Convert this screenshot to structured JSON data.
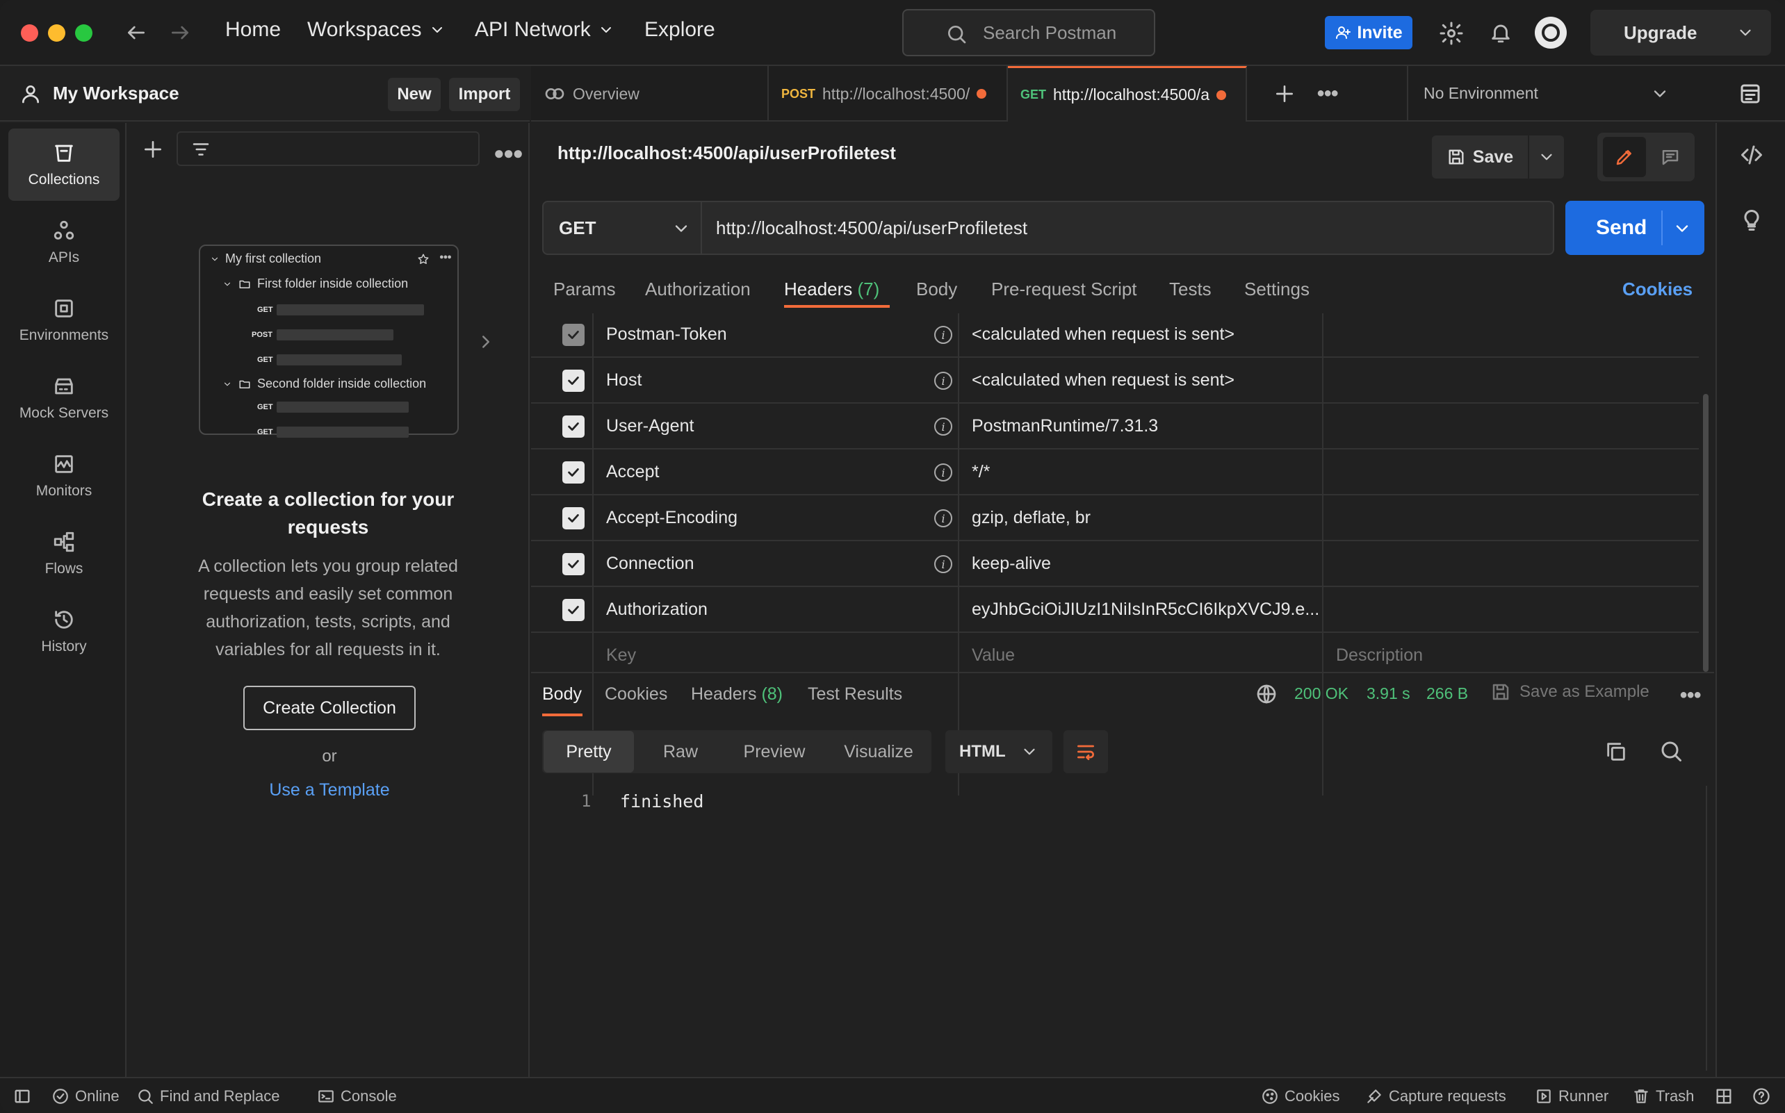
{
  "topbar": {
    "nav": {
      "home": "Home",
      "workspaces": "Workspaces",
      "api_network": "API Network",
      "explore": "Explore"
    },
    "search_placeholder": "Search Postman",
    "invite_label": "Invite",
    "upgrade_label": "Upgrade"
  },
  "workspace": {
    "title": "My Workspace",
    "new_label": "New",
    "import_label": "Import"
  },
  "leftnav": {
    "items": [
      {
        "label": "Collections",
        "icon": "collections-icon"
      },
      {
        "label": "APIs",
        "icon": "apis-icon"
      },
      {
        "label": "Environments",
        "icon": "environments-icon"
      },
      {
        "label": "Mock Servers",
        "icon": "mock-servers-icon"
      },
      {
        "label": "Monitors",
        "icon": "monitors-icon"
      },
      {
        "label": "Flows",
        "icon": "flows-icon"
      },
      {
        "label": "History",
        "icon": "history-icon"
      }
    ]
  },
  "collections": {
    "preview": {
      "collection_name": "My first collection",
      "folder1": "First folder inside collection",
      "folder2": "Second folder inside collection",
      "methods": [
        "GET",
        "POST",
        "GET",
        "GET",
        "GET"
      ]
    },
    "empty_title": "Create a collection for your requests",
    "empty_text": "A collection lets you group related requests and easily set common authorization, tests, scripts, and variables for all requests in it.",
    "create_button": "Create Collection",
    "or_text": "or",
    "template_link": "Use a Template"
  },
  "tabs": {
    "overview": "Overview",
    "tab1": {
      "method": "POST",
      "url": "http://localhost:4500/"
    },
    "tab2": {
      "method": "GET",
      "url": "http://localhost:4500/a"
    },
    "environment": "No Environment"
  },
  "request": {
    "title": "http://localhost:4500/api/userProfiletest",
    "save_label": "Save",
    "method": "GET",
    "url": "http://localhost:4500/api/userProfiletest",
    "send_label": "Send",
    "tabs": {
      "params": "Params",
      "authorization": "Authorization",
      "headers": "Headers",
      "headers_count": "(7)",
      "body": "Body",
      "prerequest": "Pre-request Script",
      "tests": "Tests",
      "settings": "Settings",
      "cookies": "Cookies"
    },
    "headers": [
      {
        "key": "Postman-Token",
        "value": "<calculated when request is sent>",
        "checked": true,
        "disabled": true
      },
      {
        "key": "Host",
        "value": "<calculated when request is sent>",
        "checked": true
      },
      {
        "key": "User-Agent",
        "value": "PostmanRuntime/7.31.3",
        "checked": true
      },
      {
        "key": "Accept",
        "value": "*/*",
        "checked": true
      },
      {
        "key": "Accept-Encoding",
        "value": "gzip, deflate, br",
        "checked": true
      },
      {
        "key": "Connection",
        "value": "keep-alive",
        "checked": true
      },
      {
        "key": "Authorization",
        "value": "eyJhbGciOiJIUzI1NiIsInR5cCI6IkpXVCJ9.e...",
        "checked": true
      }
    ],
    "new_row": {
      "key": "Key",
      "value": "Value",
      "description": "Description"
    }
  },
  "response": {
    "tabs": {
      "body": "Body",
      "cookies": "Cookies",
      "headers": "Headers",
      "headers_count": "(8)",
      "test_results": "Test Results"
    },
    "status": "200 OK",
    "time": "3.91 s",
    "size": "266 B",
    "save_example": "Save as Example",
    "views": {
      "pretty": "Pretty",
      "raw": "Raw",
      "preview": "Preview",
      "visualize": "Visualize"
    },
    "format": "HTML",
    "line_number": "1",
    "body_text": "finished"
  },
  "statusbar": {
    "online": "Online",
    "find_replace": "Find and Replace",
    "console": "Console",
    "cookies": "Cookies",
    "capture": "Capture requests",
    "runner": "Runner",
    "trash": "Trash"
  },
  "colors": {
    "accent": "#1d6be0",
    "orange": "#f26b3a",
    "success": "#4fc27a",
    "get": "#4fc27a",
    "post": "#f0b63f"
  }
}
